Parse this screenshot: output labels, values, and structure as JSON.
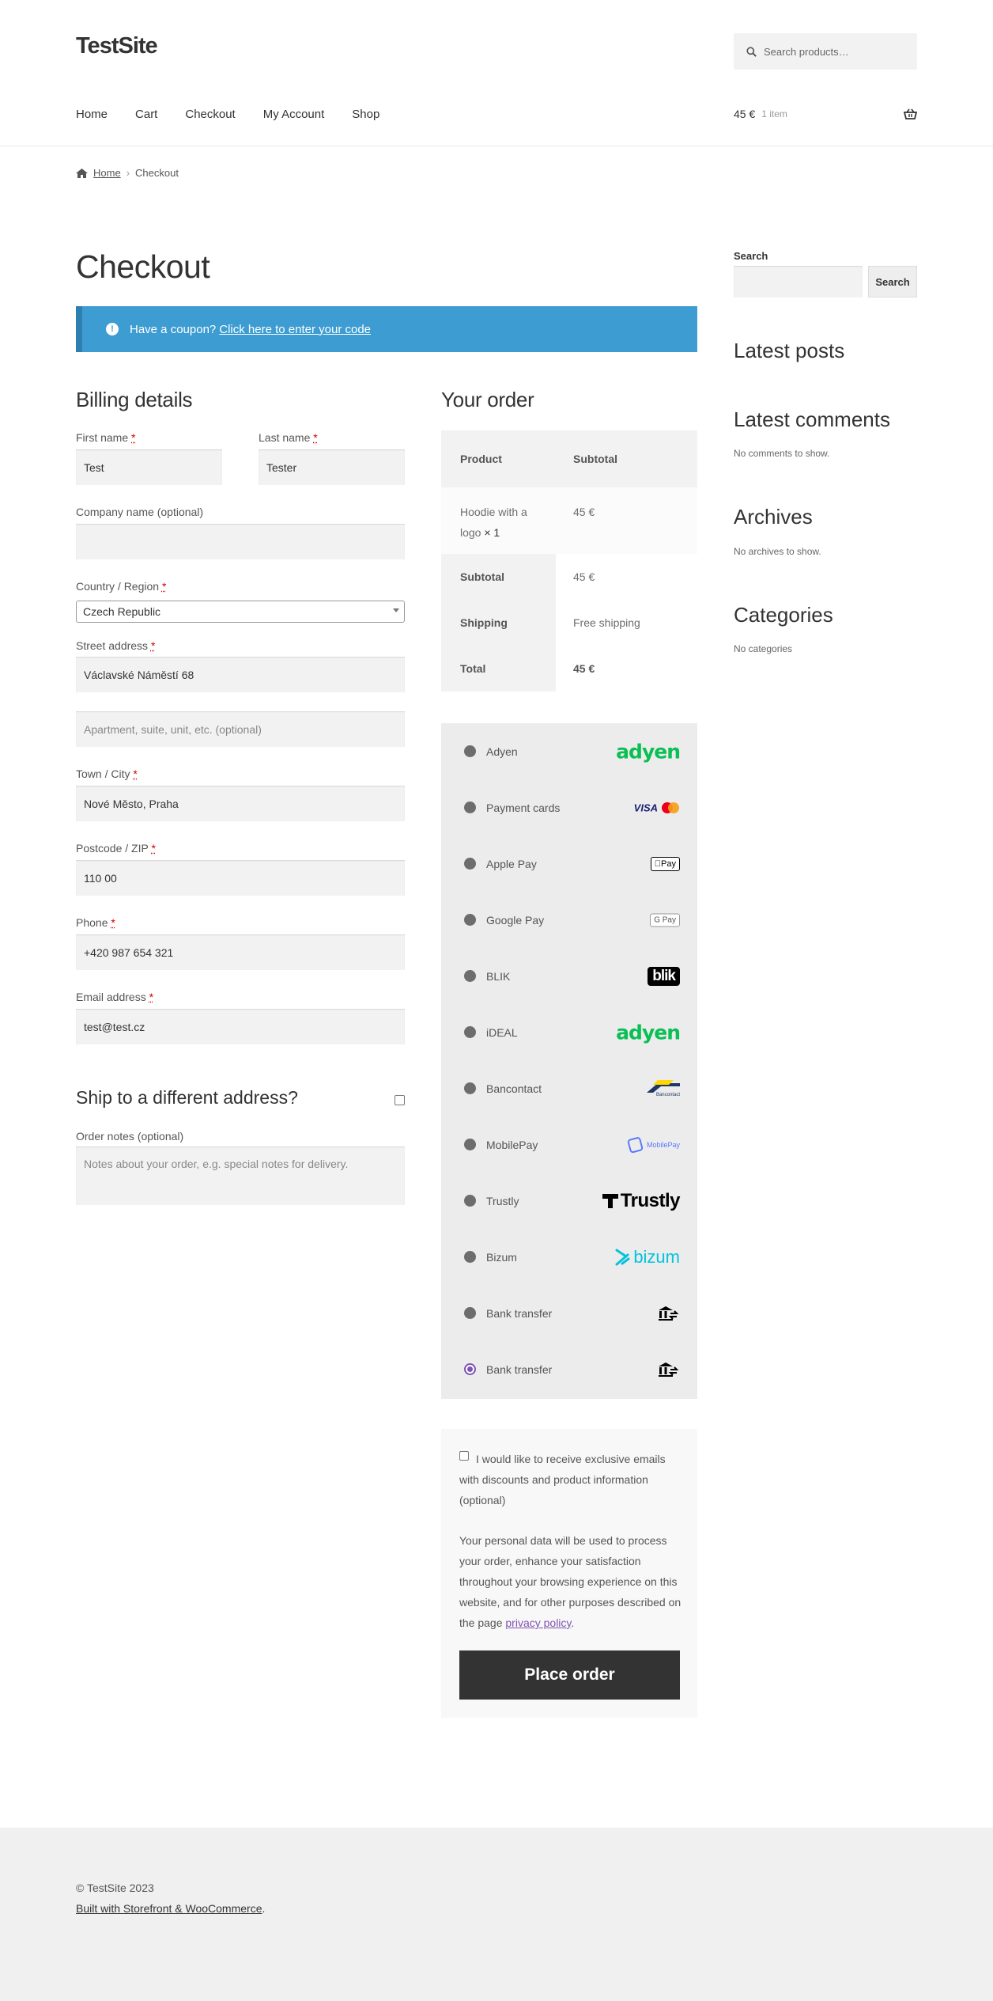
{
  "site": {
    "title": "TestSite"
  },
  "header": {
    "search_placeholder": "Search products…",
    "nav": [
      "Home",
      "Cart",
      "Checkout",
      "My Account",
      "Shop"
    ],
    "cart_total": "45 €",
    "cart_items": "1 item"
  },
  "breadcrumb": {
    "home": "Home",
    "current": "Checkout"
  },
  "page_title": "Checkout",
  "coupon": {
    "text": "Have a coupon?",
    "link": "Click here to enter your code"
  },
  "billing": {
    "heading": "Billing details",
    "first_name_label": "First name",
    "first_name": "Test",
    "last_name_label": "Last name",
    "last_name": "Tester",
    "company_label": "Company name (optional)",
    "country_label": "Country / Region",
    "country": "Czech Republic",
    "street_label": "Street address",
    "street": "Václavské Náměstí 68",
    "apartment_placeholder": "Apartment, suite, unit, etc. (optional)",
    "city_label": "Town / City",
    "city": "Nové Město, Praha",
    "postcode_label": "Postcode / ZIP",
    "postcode": "110 00",
    "phone_label": "Phone",
    "phone": "+420 987 654 321",
    "email_label": "Email address",
    "email": "test@test.cz",
    "required_mark": "*"
  },
  "shipping": {
    "heading": "Ship to a different address?"
  },
  "notes": {
    "label": "Order notes (optional)",
    "placeholder": "Notes about your order, e.g. special notes for delivery."
  },
  "order": {
    "heading": "Your order",
    "col_product": "Product",
    "col_subtotal": "Subtotal",
    "item_name": "Hoodie with a logo",
    "item_qty": "× 1",
    "item_total": "45 €",
    "subtotal_label": "Subtotal",
    "subtotal": "45 €",
    "shipping_label": "Shipping",
    "shipping": "Free shipping",
    "total_label": "Total",
    "total": "45 €"
  },
  "payments": [
    {
      "label": "Adyen",
      "logo": "adyen"
    },
    {
      "label": "Payment cards",
      "logo": "cards"
    },
    {
      "label": "Apple Pay",
      "logo": "applepay"
    },
    {
      "label": "Google Pay",
      "logo": "googlepay"
    },
    {
      "label": "BLIK",
      "logo": "blik"
    },
    {
      "label": "iDEAL",
      "logo": "adyen"
    },
    {
      "label": "Bancontact",
      "logo": "bancontact"
    },
    {
      "label": "MobilePay",
      "logo": "mobilepay"
    },
    {
      "label": "Trustly",
      "logo": "trustly"
    },
    {
      "label": "Bizum",
      "logo": "bizum"
    },
    {
      "label": "Bank transfer",
      "logo": "bank"
    },
    {
      "label": "Bank transfer",
      "logo": "bank",
      "selected": true
    }
  ],
  "logos": {
    "adyen": "adyen",
    "visa": "VISA",
    "applepay": "Pay",
    "googlepay": "G Pay",
    "blik": "blik",
    "bancontact": "Bancontact",
    "mobilepay": "MobilePay",
    "trustly": "Trustly",
    "bizum": "bizum"
  },
  "terms": {
    "newsletter": "I would like to receive exclusive emails with discounts and product information (optional)",
    "privacy_text": "Your personal data will be used to process your order, enhance your satisfaction throughout your browsing experience on this website, and for other purposes described on the page",
    "privacy_link": "privacy policy",
    "privacy_end": ".",
    "place_order": "Place order"
  },
  "sidebar": {
    "search_label": "Search",
    "search_button": "Search",
    "latest_posts": "Latest posts",
    "latest_comments": "Latest comments",
    "no_comments": "No comments to show.",
    "archives": "Archives",
    "no_archives": "No archives to show.",
    "categories": "Categories",
    "no_categories": "No categories"
  },
  "footer": {
    "copyright": "© TestSite 2023",
    "built_with": "Built with Storefront & WooCommerce",
    "built_end": "."
  },
  "colors": {
    "accent": "#3d9cd2",
    "purple": "#7f54b3",
    "button": "#333333"
  }
}
